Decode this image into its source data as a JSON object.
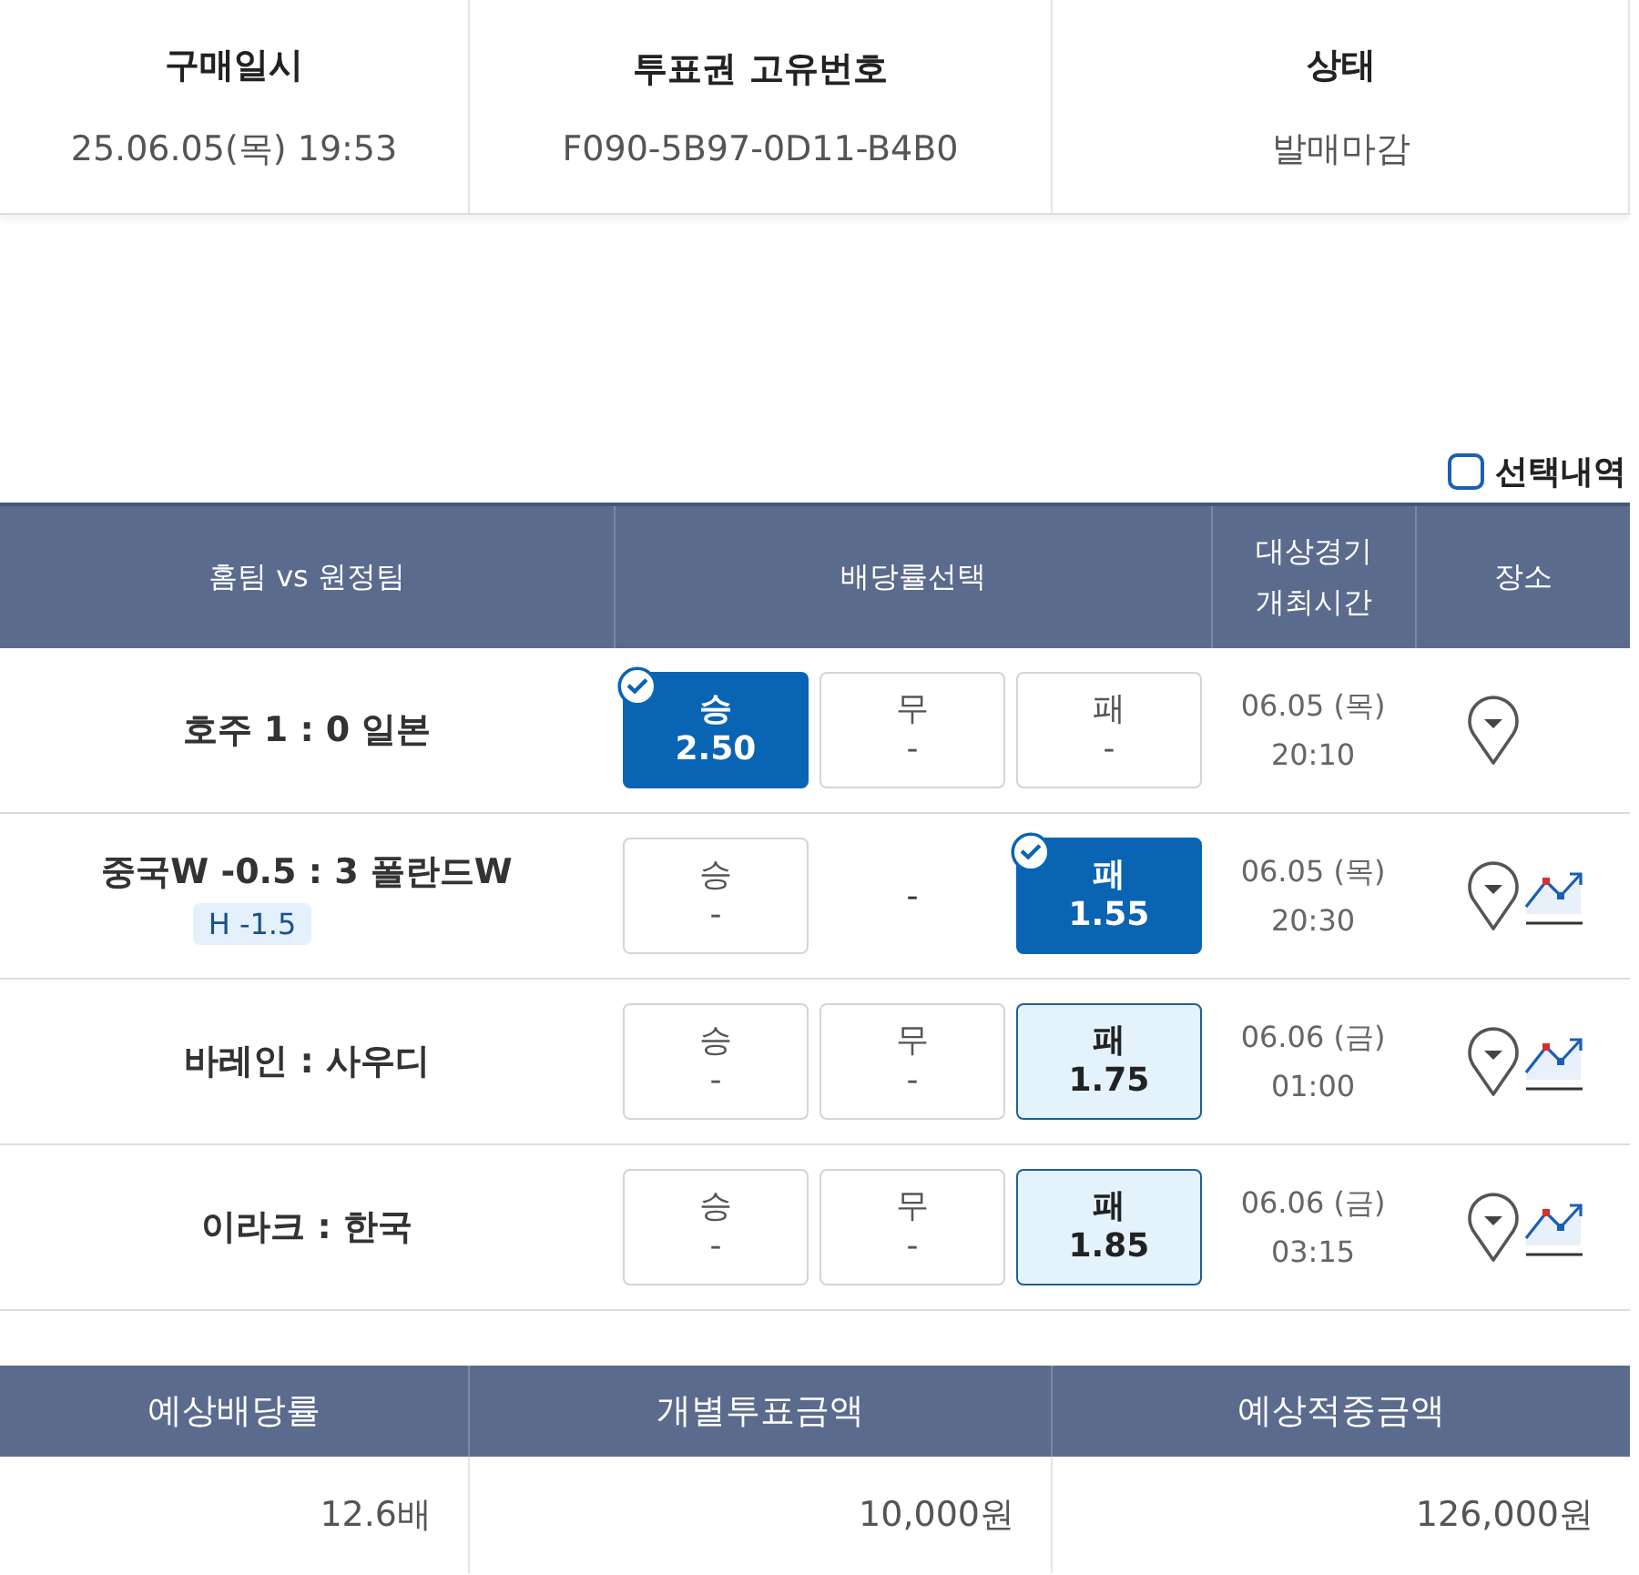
{
  "ticket_info": {
    "columns": [
      {
        "heading": "구매일시",
        "value": "25.06.05(목) 19:53"
      },
      {
        "heading": "투표권 고유번호",
        "value": "F090-5B97-0D11-B4B0"
      },
      {
        "heading": "상태",
        "value": "발매마감"
      }
    ]
  },
  "selection_toggle": {
    "label": "선택내역",
    "checked": false
  },
  "matches": {
    "columns": [
      "홈팀 vs 원정팀",
      "배당률선택",
      "대상경기\n개최시간",
      "장소"
    ],
    "rows": [
      {
        "match": "호주 1 : 0 일본",
        "handicap": null,
        "options": [
          {
            "kind": "box",
            "label": "승",
            "odds": "2.50",
            "selected": true,
            "highlighted": false
          },
          {
            "kind": "box",
            "label": "무",
            "odds": "-",
            "selected": false,
            "highlighted": false
          },
          {
            "kind": "box",
            "label": "패",
            "odds": "-",
            "selected": false,
            "highlighted": false
          }
        ],
        "date": "06.05 (목)",
        "time": "20:10",
        "chart": false
      },
      {
        "match": "중국W -0.5 : 3 폴란드W",
        "handicap": "H -1.5",
        "options": [
          {
            "kind": "box",
            "label": "승",
            "odds": "-",
            "selected": false,
            "highlighted": false
          },
          {
            "kind": "none",
            "odds": "-"
          },
          {
            "kind": "box",
            "label": "패",
            "odds": "1.55",
            "selected": true,
            "highlighted": false
          }
        ],
        "date": "06.05 (목)",
        "time": "20:30",
        "chart": true
      },
      {
        "match": "바레인 : 사우디",
        "handicap": null,
        "options": [
          {
            "kind": "box",
            "label": "승",
            "odds": "-",
            "selected": false,
            "highlighted": false
          },
          {
            "kind": "box",
            "label": "무",
            "odds": "-",
            "selected": false,
            "highlighted": false
          },
          {
            "kind": "box",
            "label": "패",
            "odds": "1.75",
            "selected": false,
            "highlighted": true
          }
        ],
        "date": "06.06 (금)",
        "time": "01:00",
        "chart": true
      },
      {
        "match": "이라크 : 한국",
        "handicap": null,
        "options": [
          {
            "kind": "box",
            "label": "승",
            "odds": "-",
            "selected": false,
            "highlighted": false
          },
          {
            "kind": "box",
            "label": "무",
            "odds": "-",
            "selected": false,
            "highlighted": false
          },
          {
            "kind": "box",
            "label": "패",
            "odds": "1.85",
            "selected": false,
            "highlighted": true
          }
        ],
        "date": "06.06 (금)",
        "time": "03:15",
        "chart": true
      }
    ]
  },
  "summary": {
    "columns": [
      {
        "heading": "예상배당률",
        "value": "12.6배"
      },
      {
        "heading": "개별투표금액",
        "value": "10,000원"
      },
      {
        "heading": "예상적중금액",
        "value": "126,000원"
      }
    ]
  }
}
